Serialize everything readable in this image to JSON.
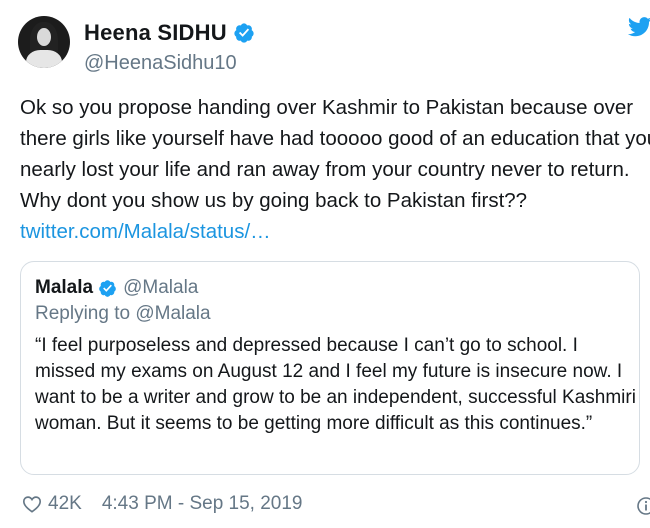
{
  "author": {
    "display_name": "Heena SIDHU",
    "handle": "@HeenaSidhu10",
    "verified": true
  },
  "tweet": {
    "text": "Ok so you propose handing over Kashmir to Pakistan because over there girls like yourself have had tooooo good of an education that you nearly lost your life and ran away from your country never to return. Why dont you show us by going back to Pakistan first?? ",
    "link": "twitter.com/Malala/status/…"
  },
  "quoted_tweet": {
    "display_name": "Malala",
    "handle": "@Malala",
    "verified": true,
    "replying_to": "Replying to @Malala",
    "text": "“I feel purposeless and depressed because I can’t go to school. I missed my exams on August 12 and I feel my future is insecure now. I want to be a writer and grow to be an independent, successful Kashmiri woman. But it seems to be getting more difficult as this continues.”"
  },
  "footer": {
    "likes": "42K",
    "timestamp": "4:43 PM - Sep 15, 2019"
  },
  "colors": {
    "link": "#1b95e0",
    "secondary_text": "#657786",
    "verified": "#1da1f2",
    "border": "#d6dde3"
  },
  "icons": {
    "verified": "verified-badge-icon",
    "brand": "twitter-bird-icon",
    "like": "heart-icon",
    "info": "info-icon"
  }
}
